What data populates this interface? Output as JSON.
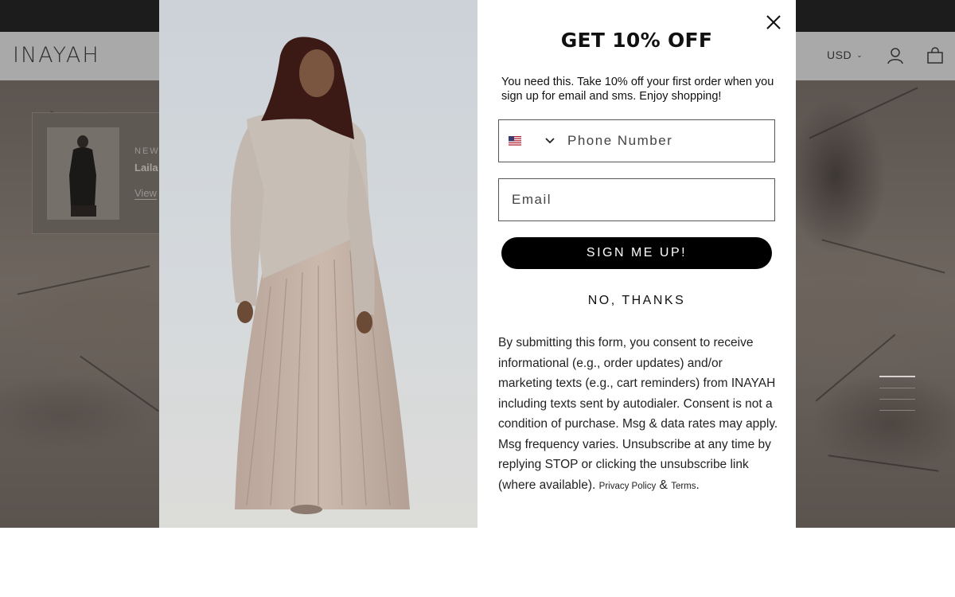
{
  "header": {
    "logo": "INAYAH",
    "currency": "USD",
    "account_icon": "account-icon",
    "cart_icon": "cart-icon"
  },
  "hero": {
    "product_card": {
      "tag": "NEW",
      "name": "Laila",
      "link": "View"
    },
    "slides": 4,
    "active_slide": 1
  },
  "popup": {
    "title": "GET 10% OFF",
    "subtitle": "You need this. Take 10% off your first order when you sign up for email and sms. Enjoy shopping!",
    "phone_placeholder": "Phone Number",
    "email_placeholder": "Email",
    "signup_label": "SIGN ME UP!",
    "no_thanks_label": "NO, THANKS",
    "consent_text": "By submitting this form, you consent to receive informational (e.g., order updates) and/or marketing texts (e.g., cart reminders) from INAYAH including texts sent by autodialer. Consent is not a condition of purchase. Msg & data rates may apply. Msg frequency varies. Unsubscribe at any time by replying STOP or clicking the unsubscribe link (where available).",
    "privacy_link": "Privacy Policy",
    "ampersand": "&",
    "terms_link": "Terms",
    "terms_period": ".",
    "country_flag": "us-flag-icon"
  },
  "colors": {
    "announcement_bg": "#1c1c1c",
    "overlay_header": "#a9a9a9",
    "button_bg": "#000000"
  }
}
